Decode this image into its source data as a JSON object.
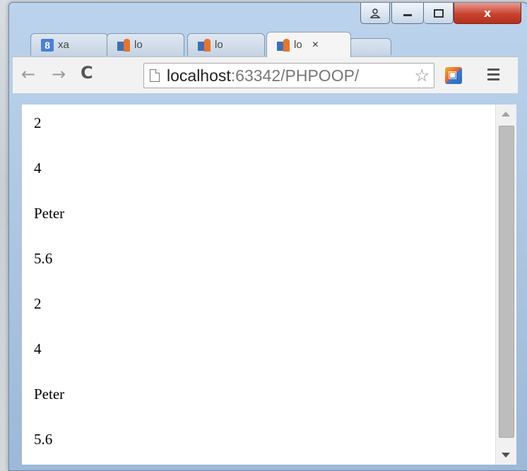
{
  "window": {
    "caption_buttons": {
      "user_icon": "user-icon",
      "minimize": "minimize-icon",
      "maximize": "maximize-icon",
      "close_glyph": "x"
    }
  },
  "tabs": [
    {
      "icon": "google-icon",
      "icon_glyph": "8",
      "label": "xa"
    },
    {
      "icon": "phpstorm-icon",
      "label": "lo"
    },
    {
      "icon": "phpstorm-icon",
      "label": "lo"
    },
    {
      "icon": "phpstorm-icon",
      "label": "lo",
      "active": true,
      "close_glyph": "×"
    }
  ],
  "toolbar": {
    "back_glyph": "←",
    "forward_glyph": "→",
    "reload_glyph": "C",
    "url_host": "localhost",
    "url_path": ":63342/PHPOOP/",
    "star_glyph": "☆",
    "extension_icon": "shopping-cart-icon",
    "menu_icon": "hamburger-menu-icon"
  },
  "page": {
    "lines": [
      "2",
      "4",
      "Peter",
      "5.6",
      "2",
      "4",
      "Peter",
      "5.6"
    ]
  },
  "colors": {
    "close_button": "#c8432f",
    "chrome_frame": "#a9c3e0"
  }
}
